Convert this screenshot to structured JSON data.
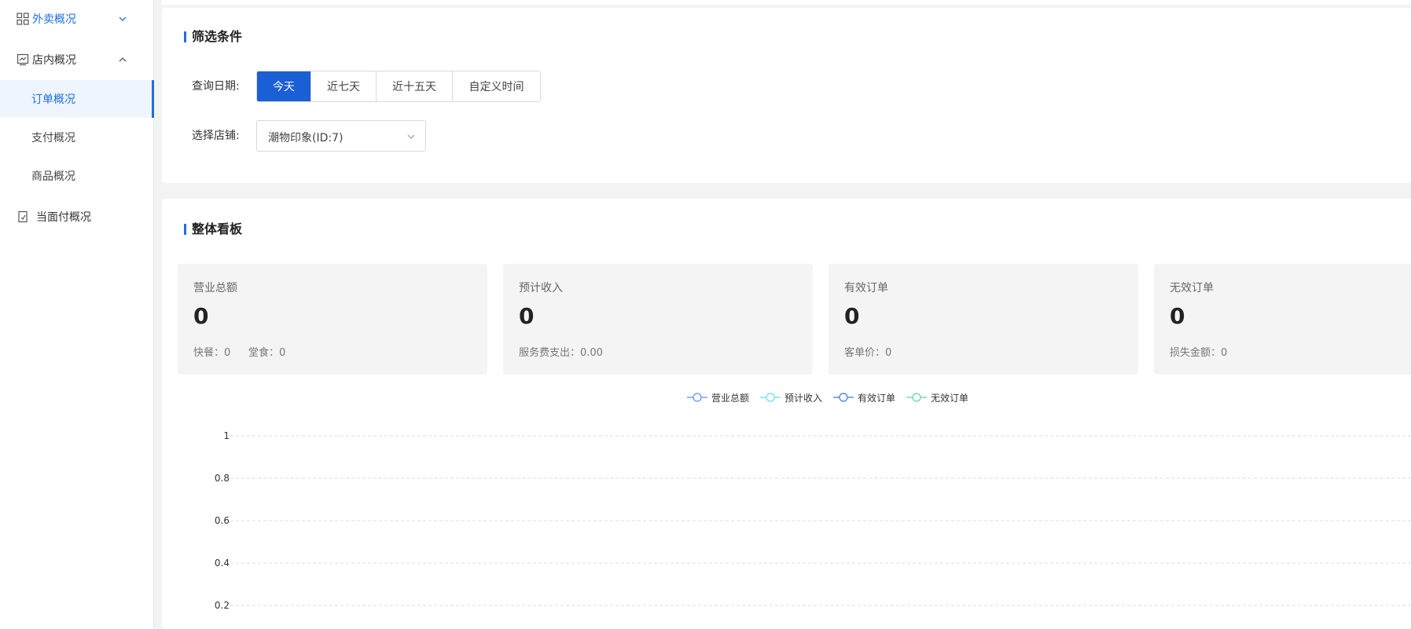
{
  "sidebar": {
    "items": [
      {
        "label": "外卖概况",
        "icon": "grid-icon"
      },
      {
        "label": "店内概况",
        "icon": "chart-board-icon"
      },
      {
        "label": "当面付概况",
        "icon": "receipt-icon"
      }
    ],
    "sub_items": [
      {
        "label": "订单概况"
      },
      {
        "label": "支付概况"
      },
      {
        "label": "商品概况"
      }
    ]
  },
  "filter": {
    "title": "筛选条件",
    "date_label": "查询日期:",
    "date_options": [
      "今天",
      "近七天",
      "近十五天",
      "自定义时间"
    ],
    "selected_date": "今天",
    "store_label": "选择店铺:",
    "store_value": "潮物印象(ID:7)"
  },
  "board": {
    "title": "整体看板",
    "stats": [
      {
        "label": "营业总额",
        "value": "0",
        "sub": "快餐：0",
        "sub2": "堂食：0"
      },
      {
        "label": "预计收入",
        "value": "0",
        "sub": "服务费支出：0.00"
      },
      {
        "label": "有效订单",
        "value": "0",
        "sub": "客单价：0"
      },
      {
        "label": "无效订单",
        "value": "0",
        "sub": "损失金额：0"
      }
    ]
  },
  "colors": {
    "accent": "#1f6fe0",
    "primary_button": "#1a5fd6"
  },
  "chart_data": {
    "type": "line",
    "series": [
      {
        "name": "营业总额",
        "color": "#5b8ff9",
        "values": []
      },
      {
        "name": "预计收入",
        "color": "#61ddfc",
        "values": []
      },
      {
        "name": "有效订单",
        "color": "#3a7bd5",
        "values": []
      },
      {
        "name": "无效订单",
        "color": "#5ad8a6",
        "values": []
      }
    ],
    "y_ticks": [
      "1",
      "0.8",
      "0.6",
      "0.4",
      "0.2"
    ],
    "ylim": [
      0,
      1
    ],
    "grid": true,
    "legend_position": "top-center"
  }
}
